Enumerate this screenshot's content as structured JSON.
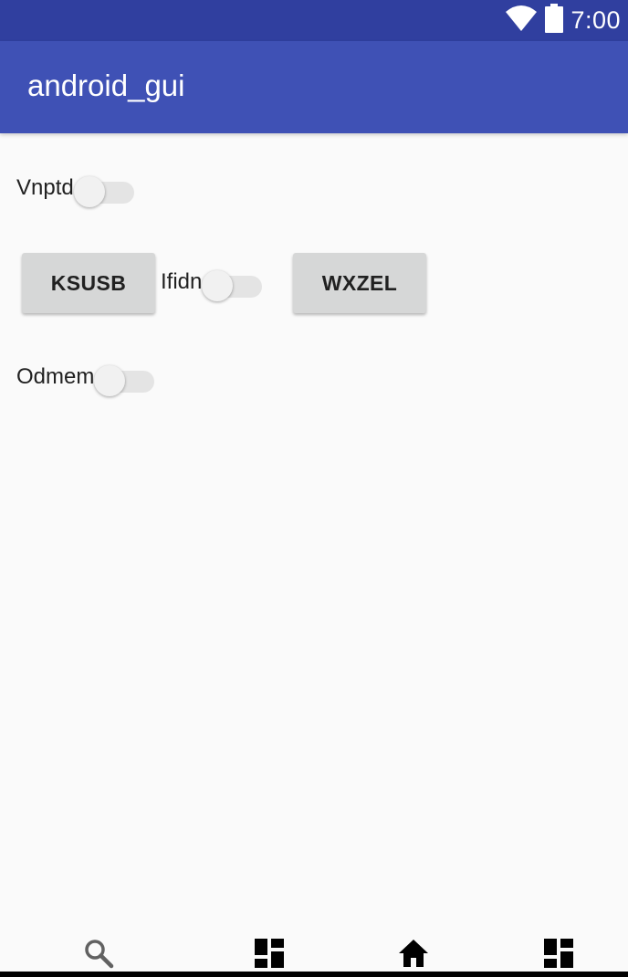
{
  "status_bar": {
    "time": "7:00",
    "icons": [
      "wifi-icon",
      "battery-icon"
    ]
  },
  "app_bar": {
    "title": "android_gui"
  },
  "content": {
    "switch_vnptd": {
      "label": "Vnptd",
      "checked": false
    },
    "button_ksusb": {
      "label": "KSUSB"
    },
    "switch_ifidn": {
      "label": "Ifidn",
      "checked": false
    },
    "button_wxzel": {
      "label": "WXZEL"
    },
    "switch_odmem": {
      "label": "Odmem",
      "checked": false
    }
  },
  "bottom_nav": {
    "items": [
      "search-icon",
      "dashboard-icon",
      "home-icon",
      "dashboard-icon"
    ]
  },
  "colors": {
    "status_bar": "#303f9f",
    "app_bar": "#3f51b5",
    "background": "#fafafa",
    "button": "#d6d7d7"
  }
}
